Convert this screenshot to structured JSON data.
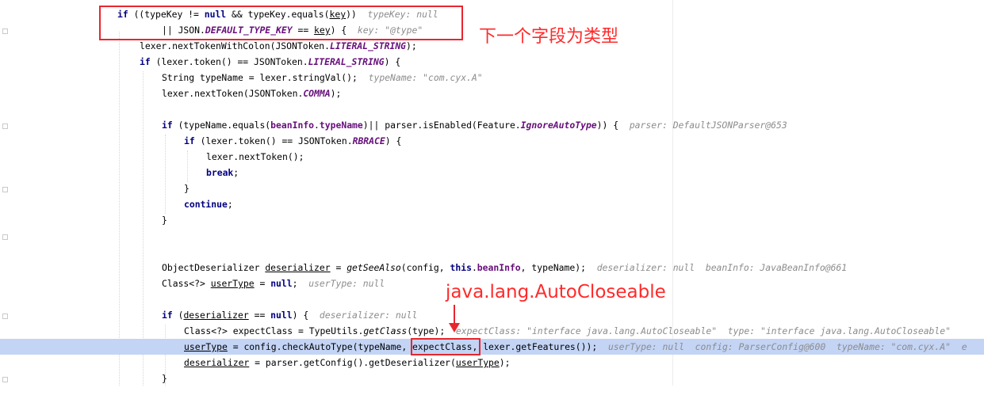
{
  "lines": [
    {
      "t1": "if",
      "t2": " ((typeKey != ",
      "t3": "null",
      "t4": " && typeKey.equals(",
      "t5": "key",
      "t6": "))",
      "hint": "typeKey: null"
    },
    {
      "t1": "|| JSON.",
      "t2": "DEFAULT_TYPE_KEY",
      "t3": " == ",
      "t4": "key",
      "t5": ") {",
      "hint": "key: \"@type\""
    },
    {
      "t1": "lexer.nextTokenWithColon(JSONToken.",
      "t2": "LITERAL_STRING",
      "t3": ");"
    },
    {
      "t1": "if",
      "t2": " (lexer.token() == JSONToken.",
      "t3": "LITERAL_STRING",
      "t4": ") {"
    },
    {
      "t1": "String typeName = lexer.stringVal();",
      "hint": "typeName: \"com.cyx.A\""
    },
    {
      "t1": "lexer.nextToken(JSONToken.",
      "t2": "COMMA",
      "t3": ");"
    },
    {
      "t1": "if",
      "t2": " (typeName.equals(",
      "t3": "beanInfo",
      "t4": ".",
      "t5": "typeName",
      "t6": ")|| parser.isEnabled(Feature.",
      "t7": "IgnoreAutoType",
      "t8": ")) {",
      "hint": "parser: DefaultJSONParser@653"
    },
    {
      "t1": "if",
      "t2": " (lexer.token() == JSONToken.",
      "t3": "RBRACE",
      "t4": ") {"
    },
    {
      "t1": "lexer.nextToken();"
    },
    {
      "t1": "break",
      "t2": ";"
    },
    {
      "t1": "}"
    },
    {
      "t1": "continue",
      "t2": ";"
    },
    {
      "t1": "}"
    },
    {
      "t1": "ObjectDeserializer ",
      "t2": "deserializer",
      "t3": " = ",
      "t4": "getSeeAlso",
      "t5": "(config, ",
      "t6": "this",
      "t7": ".",
      "t8": "beanInfo",
      "t9": ", typeName);",
      "hint": "deserializer: null  beanInfo: JavaBeanInfo@661"
    },
    {
      "t1": "Class<?> ",
      "t2": "userType",
      "t3": " = ",
      "t4": "null",
      "t5": ";",
      "hint": "userType: null"
    },
    {
      "t1": "if",
      "t2": " (",
      "t3": "deserializer",
      "t4": " == ",
      "t5": "null",
      "t6": ") {",
      "hint": "deserializer: null"
    },
    {
      "t1": "Class<?> expectClass = TypeUtils.",
      "t2": "getClass",
      "t3": "(type);",
      "hint": "expectClass: \"interface java.lang.AutoCloseable\"  type: \"interface java.lang.AutoCloseable\""
    },
    {
      "t1": "userType",
      "t2": " = config.checkAutoType(typeName, ",
      "t3": "expectClass",
      "t4": ", lexer.getFeatures());",
      "hint": "userType: null  config: ParserConfig@600  typeName: \"com.cyx.A\"  e"
    },
    {
      "t1": "deserializer",
      "t2": " = parser.getConfig().getDeserializer(",
      "t3": "userType",
      "t4": ");"
    },
    {
      "t1": "}"
    }
  ],
  "annotations": {
    "type_field_note": "下一个字段为类型",
    "expect_class_note": "java.lang.AutoCloseable"
  },
  "colors": {
    "keyword": "#000080",
    "field": "#660e7a",
    "hint": "#8c8c8c",
    "current_line": "#c3d4f5",
    "annotation_red": "#e8262e"
  }
}
